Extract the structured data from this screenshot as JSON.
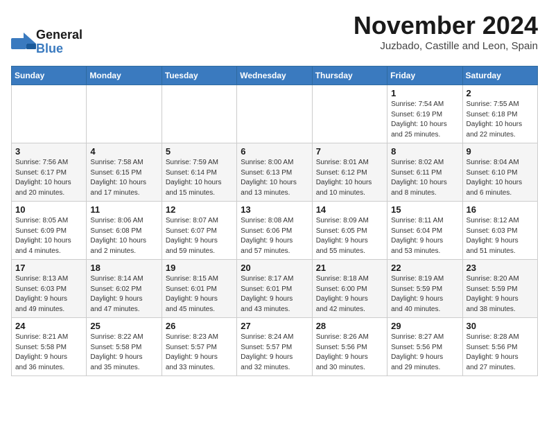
{
  "logo": {
    "line1": "General",
    "line2": "Blue"
  },
  "title": "November 2024",
  "location": "Juzbado, Castille and Leon, Spain",
  "headers": [
    "Sunday",
    "Monday",
    "Tuesday",
    "Wednesday",
    "Thursday",
    "Friday",
    "Saturday"
  ],
  "weeks": [
    [
      {
        "day": "",
        "info": ""
      },
      {
        "day": "",
        "info": ""
      },
      {
        "day": "",
        "info": ""
      },
      {
        "day": "",
        "info": ""
      },
      {
        "day": "",
        "info": ""
      },
      {
        "day": "1",
        "info": "Sunrise: 7:54 AM\nSunset: 6:19 PM\nDaylight: 10 hours\nand 25 minutes."
      },
      {
        "day": "2",
        "info": "Sunrise: 7:55 AM\nSunset: 6:18 PM\nDaylight: 10 hours\nand 22 minutes."
      }
    ],
    [
      {
        "day": "3",
        "info": "Sunrise: 7:56 AM\nSunset: 6:17 PM\nDaylight: 10 hours\nand 20 minutes."
      },
      {
        "day": "4",
        "info": "Sunrise: 7:58 AM\nSunset: 6:15 PM\nDaylight: 10 hours\nand 17 minutes."
      },
      {
        "day": "5",
        "info": "Sunrise: 7:59 AM\nSunset: 6:14 PM\nDaylight: 10 hours\nand 15 minutes."
      },
      {
        "day": "6",
        "info": "Sunrise: 8:00 AM\nSunset: 6:13 PM\nDaylight: 10 hours\nand 13 minutes."
      },
      {
        "day": "7",
        "info": "Sunrise: 8:01 AM\nSunset: 6:12 PM\nDaylight: 10 hours\nand 10 minutes."
      },
      {
        "day": "8",
        "info": "Sunrise: 8:02 AM\nSunset: 6:11 PM\nDaylight: 10 hours\nand 8 minutes."
      },
      {
        "day": "9",
        "info": "Sunrise: 8:04 AM\nSunset: 6:10 PM\nDaylight: 10 hours\nand 6 minutes."
      }
    ],
    [
      {
        "day": "10",
        "info": "Sunrise: 8:05 AM\nSunset: 6:09 PM\nDaylight: 10 hours\nand 4 minutes."
      },
      {
        "day": "11",
        "info": "Sunrise: 8:06 AM\nSunset: 6:08 PM\nDaylight: 10 hours\nand 2 minutes."
      },
      {
        "day": "12",
        "info": "Sunrise: 8:07 AM\nSunset: 6:07 PM\nDaylight: 9 hours\nand 59 minutes."
      },
      {
        "day": "13",
        "info": "Sunrise: 8:08 AM\nSunset: 6:06 PM\nDaylight: 9 hours\nand 57 minutes."
      },
      {
        "day": "14",
        "info": "Sunrise: 8:09 AM\nSunset: 6:05 PM\nDaylight: 9 hours\nand 55 minutes."
      },
      {
        "day": "15",
        "info": "Sunrise: 8:11 AM\nSunset: 6:04 PM\nDaylight: 9 hours\nand 53 minutes."
      },
      {
        "day": "16",
        "info": "Sunrise: 8:12 AM\nSunset: 6:03 PM\nDaylight: 9 hours\nand 51 minutes."
      }
    ],
    [
      {
        "day": "17",
        "info": "Sunrise: 8:13 AM\nSunset: 6:03 PM\nDaylight: 9 hours\nand 49 minutes."
      },
      {
        "day": "18",
        "info": "Sunrise: 8:14 AM\nSunset: 6:02 PM\nDaylight: 9 hours\nand 47 minutes."
      },
      {
        "day": "19",
        "info": "Sunrise: 8:15 AM\nSunset: 6:01 PM\nDaylight: 9 hours\nand 45 minutes."
      },
      {
        "day": "20",
        "info": "Sunrise: 8:17 AM\nSunset: 6:01 PM\nDaylight: 9 hours\nand 43 minutes."
      },
      {
        "day": "21",
        "info": "Sunrise: 8:18 AM\nSunset: 6:00 PM\nDaylight: 9 hours\nand 42 minutes."
      },
      {
        "day": "22",
        "info": "Sunrise: 8:19 AM\nSunset: 5:59 PM\nDaylight: 9 hours\nand 40 minutes."
      },
      {
        "day": "23",
        "info": "Sunrise: 8:20 AM\nSunset: 5:59 PM\nDaylight: 9 hours\nand 38 minutes."
      }
    ],
    [
      {
        "day": "24",
        "info": "Sunrise: 8:21 AM\nSunset: 5:58 PM\nDaylight: 9 hours\nand 36 minutes."
      },
      {
        "day": "25",
        "info": "Sunrise: 8:22 AM\nSunset: 5:58 PM\nDaylight: 9 hours\nand 35 minutes."
      },
      {
        "day": "26",
        "info": "Sunrise: 8:23 AM\nSunset: 5:57 PM\nDaylight: 9 hours\nand 33 minutes."
      },
      {
        "day": "27",
        "info": "Sunrise: 8:24 AM\nSunset: 5:57 PM\nDaylight: 9 hours\nand 32 minutes."
      },
      {
        "day": "28",
        "info": "Sunrise: 8:26 AM\nSunset: 5:56 PM\nDaylight: 9 hours\nand 30 minutes."
      },
      {
        "day": "29",
        "info": "Sunrise: 8:27 AM\nSunset: 5:56 PM\nDaylight: 9 hours\nand 29 minutes."
      },
      {
        "day": "30",
        "info": "Sunrise: 8:28 AM\nSunset: 5:56 PM\nDaylight: 9 hours\nand 27 minutes."
      }
    ]
  ]
}
